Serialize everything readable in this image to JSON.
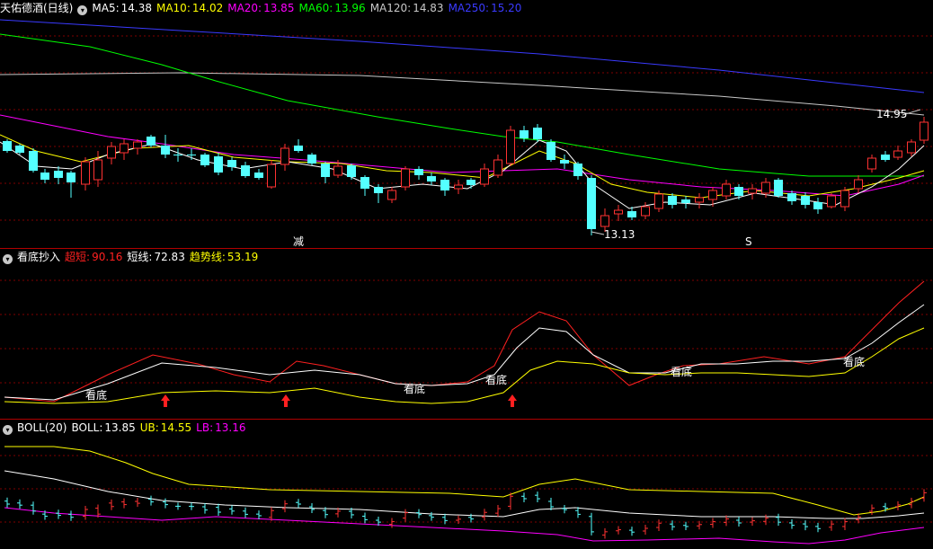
{
  "main": {
    "title": "天佑德酒(日线)",
    "ma": [
      {
        "label": "MA5:",
        "value": "14.38",
        "color": "#ffffff"
      },
      {
        "label": "MA10:",
        "value": "14.02",
        "color": "#ffff00"
      },
      {
        "label": "MA20:",
        "value": "13.85",
        "color": "#ff00ff"
      },
      {
        "label": "MA60:",
        "value": "13.96",
        "color": "#00ff00"
      },
      {
        "label": "MA120:",
        "value": "14.83",
        "color": "#c8c8c8"
      },
      {
        "label": "MA250:",
        "value": "15.20",
        "color": "#3a3aff"
      }
    ],
    "high_marker": "14.95",
    "low_marker": "13.13",
    "marker_jian": "减",
    "marker_s": "S"
  },
  "indicator": {
    "title": "看底抄入",
    "items": [
      {
        "label": "超短:",
        "value": "90.16",
        "color": "#ff2020"
      },
      {
        "label": "短线:",
        "value": "72.83",
        "color": "#ffffff"
      },
      {
        "label": "趋势线:",
        "value": "53.19",
        "color": "#ffff00"
      }
    ],
    "signal_text": "看底"
  },
  "boll": {
    "title": "BOLL(20)",
    "items": [
      {
        "label": "BOLL:",
        "value": "13.85",
        "color": "#ffffff"
      },
      {
        "label": "UB:",
        "value": "14.55",
        "color": "#ffff00"
      },
      {
        "label": "LB:",
        "value": "13.16",
        "color": "#ff00ff"
      }
    ]
  },
  "colors": {
    "up": "#ff3232",
    "down": "#54ffff",
    "separator": "#b00000",
    "grid": "#800000",
    "arrow": "#ff2020"
  }
}
